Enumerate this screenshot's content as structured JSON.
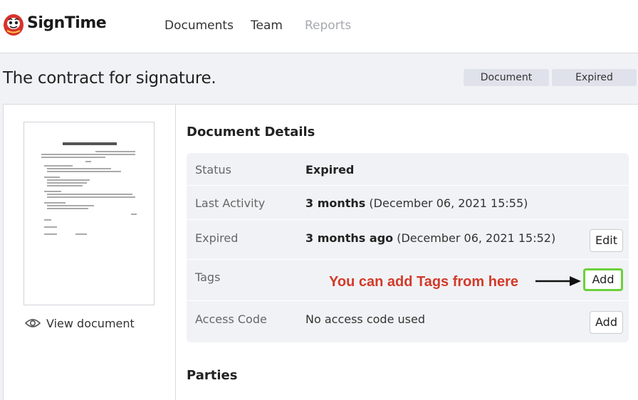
{
  "header": {
    "brand": "SignTime",
    "nav": [
      {
        "label": "Documents",
        "enabled": true
      },
      {
        "label": "Team",
        "enabled": true
      },
      {
        "label": "Reports",
        "enabled": false
      }
    ]
  },
  "page": {
    "title": "The contract for signature.",
    "badges": [
      "Document",
      "Expired"
    ]
  },
  "preview": {
    "view_label": "View document"
  },
  "details": {
    "title": "Document Details",
    "rows": [
      {
        "label": "Status",
        "value_bold": "Expired",
        "value_rest": ""
      },
      {
        "label": "Last Activity",
        "value_bold": "3 months",
        "value_rest": " (December 06, 2021 15:55)"
      },
      {
        "label": "Expired",
        "value_bold": "3 months ago",
        "value_rest": " (December 06, 2021 15:52)",
        "button": "Edit"
      },
      {
        "label": "Tags",
        "value_bold": "",
        "value_rest": "",
        "button": "Add"
      },
      {
        "label": "Access Code",
        "value_bold": "",
        "value_rest": "No access code used",
        "button": "Add"
      }
    ],
    "annotation": "You can add Tags from here"
  },
  "parties": {
    "title": "Parties"
  },
  "colors": {
    "annotation": "#d23a2a",
    "highlight_border": "#6bd13b",
    "badge_bg": "#dfe2ea",
    "page_bg": "#f1f2f5"
  },
  "icons": {
    "logo": "daruma-logo",
    "view": "eye-icon",
    "arrow": "arrow-right-icon"
  }
}
